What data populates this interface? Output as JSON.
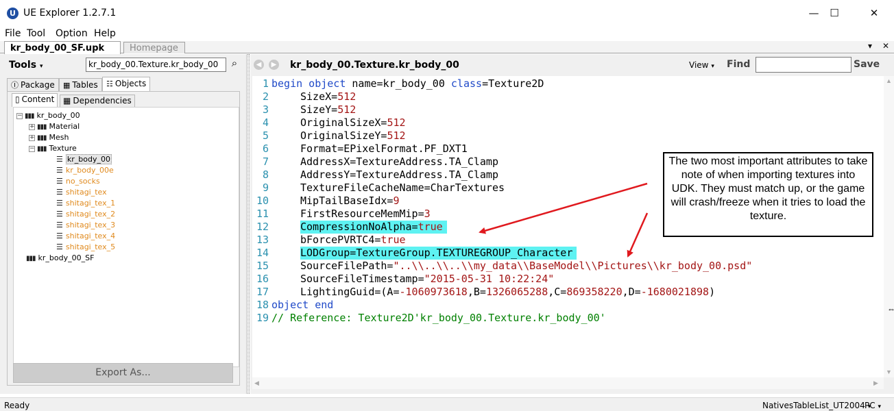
{
  "window": {
    "title": "UE Explorer 1.2.7.1",
    "app_icon_letter": "U",
    "minimize": "—",
    "maximize": "☐",
    "close": "✕"
  },
  "menu": [
    "File",
    "Tool",
    "Option",
    "Help"
  ],
  "file_tabs": {
    "active": "kr_body_00_SF.upk",
    "inactive": "Homepage"
  },
  "left": {
    "tools_label": "Tools",
    "path_value": "kr_body_00.Texture.kr_body_00",
    "tabs": [
      "Package",
      "Tables",
      "Objects"
    ],
    "subtabs": [
      "Content",
      "Dependencies"
    ],
    "tree": {
      "root": "kr_body_00",
      "groups": [
        "Material",
        "Mesh",
        "Texture"
      ],
      "textures": [
        "kr_body_00",
        "kr_body_00e",
        "no_socks",
        "shitagi_tex",
        "shitagi_tex_1",
        "shitagi_tex_2",
        "shitagi_tex_3",
        "shitagi_tex_4",
        "shitagi_tex_5"
      ],
      "second_root": "kr_body_00_SF"
    },
    "export_label": "Export As..."
  },
  "right": {
    "object_title": "kr_body_00.Texture.kr_body_00",
    "view_label": "View",
    "find_label": "Find",
    "find_value": "",
    "save_label": "Save"
  },
  "code": {
    "line_numbers": [
      "1",
      "2",
      "3",
      "4",
      "5",
      "6",
      "7",
      "8",
      "9",
      "10",
      "11",
      "12",
      "13",
      "14",
      "15",
      "16",
      "17",
      "18",
      "19"
    ],
    "l1_kw1": "begin object",
    "l1_mid": " name=kr_body_00 ",
    "l1_kw2": "class",
    "l1_end": "=Texture2D",
    "l2": "SizeX=",
    "l2v": "512",
    "l3": "SizeY=",
    "l3v": "512",
    "l4": "OriginalSizeX=",
    "l4v": "512",
    "l5": "OriginalSizeY=",
    "l5v": "512",
    "l6": "Format=EPixelFormat.PF_DXT1",
    "l7": "AddressX=TextureAddress.TA_Clamp",
    "l8": "AddressY=TextureAddress.TA_Clamp",
    "l9": "TextureFileCacheName=CharTextures",
    "l10": "MipTailBaseIdx=",
    "l10v": "9",
    "l11": "FirstResourceMemMip=",
    "l11v": "3",
    "l12": "CompressionNoAlpha=",
    "l12v": "true",
    "l13": "bForcePVRTC4=",
    "l13v": "true",
    "l14": "LODGroup=TextureGroup.TEXTUREGROUP_Character",
    "l15": "SourceFilePath=",
    "l15v": "\"..\\\\..\\\\..\\\\my_data\\\\BaseModel\\\\Pictures\\\\kr_body_00.psd\"",
    "l16": "SourceFileTimestamp=",
    "l16v": "\"2015-05-31 10:22:24\"",
    "l17": "LightingGuid=(A=",
    "l17a": "-1060973618",
    "l17b": ",B=",
    "l17c": "1326065288",
    "l17d": ",C=",
    "l17e": "869358220",
    "l17f": ",D=",
    "l17g": "-1680021898",
    "l17h": ")",
    "l18_kw1": "object",
    "l18_kw2": "end",
    "l19": "// Reference: Texture2D'kr_body_00.Texture.kr_body_00'"
  },
  "annotation": "The two most important attributes to take note of when importing textures into UDK. They must match up, or the game will crash/freeze when it tries to load the texture.",
  "status": {
    "text": "Ready",
    "table_list": "NativesTableList_UT2004",
    "platform": "PC"
  },
  "colors": {
    "highlight": "#5ef2f2",
    "arrow": "#e0191e",
    "keyword": "#1f49c8",
    "value": "#a31515",
    "comment": "#008000",
    "tree_orange": "#e08a1e"
  }
}
